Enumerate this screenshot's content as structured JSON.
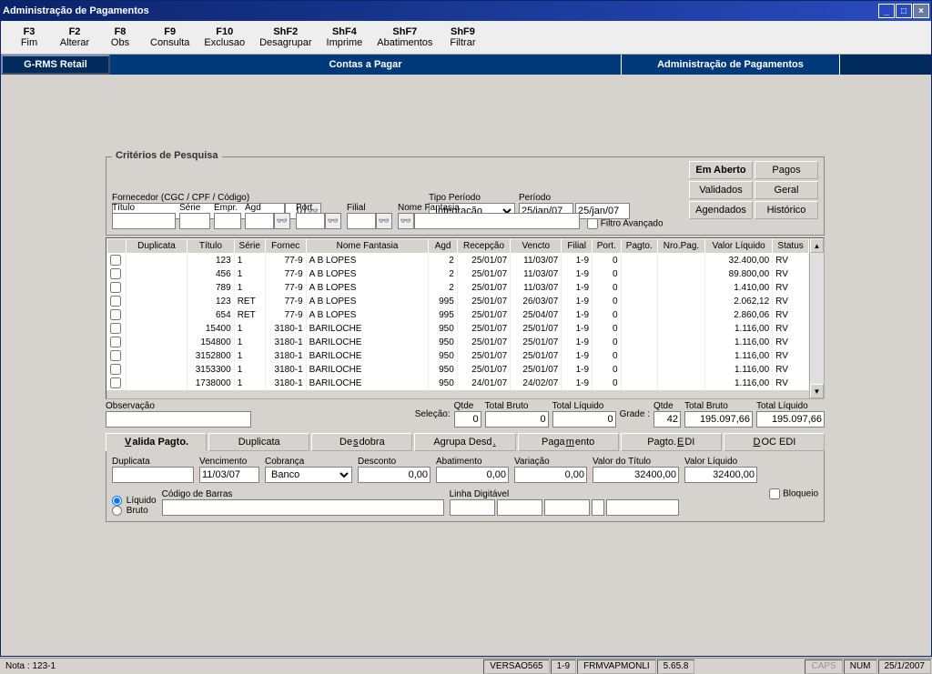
{
  "title": "Administração de Pagamentos",
  "menu": [
    {
      "key": "F3",
      "lbl": "Fim"
    },
    {
      "key": "F2",
      "lbl": "Alterar"
    },
    {
      "key": "F8",
      "lbl": "Obs"
    },
    {
      "key": "F9",
      "lbl": "Consulta"
    },
    {
      "key": "F10",
      "lbl": "Exclusao"
    },
    {
      "key": "ShF2",
      "lbl": "Desagrupar"
    },
    {
      "key": "ShF4",
      "lbl": "Imprime"
    },
    {
      "key": "ShF7",
      "lbl": "Abatimentos"
    },
    {
      "key": "ShF9",
      "lbl": "Filtrar"
    }
  ],
  "topbar": {
    "seg1": "G-RMS Retail",
    "seg2": "Contas a Pagar",
    "seg3": "Administração de Pagamentos"
  },
  "search": {
    "group": "Critérios de Pesquisa",
    "labels": {
      "fornecedor": "Fornecedor (CGC / CPF / Código)",
      "tipoPeriodo": "Tipo Período",
      "periodo": "Período",
      "titulo": "Título",
      "serie": "Série",
      "empr": "Empr.",
      "agd": "Agd",
      "port": "Port",
      "filial": "Filial",
      "nomeFant": "Nome Fantasia",
      "filtroAv": "Filtro Avançado"
    },
    "values": {
      "fornecQtd": "0",
      "tipoPeriodo": "Integração",
      "per1": "25/jan/07",
      "per2": "25/jan/07"
    },
    "buttons": {
      "emAberto": "Em Aberto",
      "pagos": "Pagos",
      "validados": "Validados",
      "geral": "Geral",
      "agendados": "Agendados",
      "historico": "Histórico"
    }
  },
  "columns": [
    "Duplicata",
    "Título",
    "Série",
    "Fornec",
    "Nome Fantasia",
    "Agd",
    "Recepção",
    "Vencto",
    "Filial",
    "Port.",
    "Pagto.",
    "Nro.Pag.",
    "Valor Líquido",
    "Status"
  ],
  "rows": [
    [
      "",
      "123",
      "1",
      "77-9",
      "A B LOPES",
      "2",
      "25/01/07",
      "11/03/07",
      "1-9",
      "0",
      "",
      "",
      "32.400,00",
      "RV"
    ],
    [
      "",
      "456",
      "1",
      "77-9",
      "A B LOPES",
      "2",
      "25/01/07",
      "11/03/07",
      "1-9",
      "0",
      "",
      "",
      "89.800,00",
      "RV"
    ],
    [
      "",
      "789",
      "1",
      "77-9",
      "A B LOPES",
      "2",
      "25/01/07",
      "11/03/07",
      "1-9",
      "0",
      "",
      "",
      "1.410,00",
      "RV"
    ],
    [
      "",
      "123",
      "RET",
      "77-9",
      "A B LOPES",
      "995",
      "25/01/07",
      "26/03/07",
      "1-9",
      "0",
      "",
      "",
      "2.062,12",
      "RV"
    ],
    [
      "",
      "654",
      "RET",
      "77-9",
      "A B LOPES",
      "995",
      "25/01/07",
      "25/04/07",
      "1-9",
      "0",
      "",
      "",
      "2.860,06",
      "RV"
    ],
    [
      "",
      "15400",
      "1",
      "3180-1",
      "BARILOCHE",
      "950",
      "25/01/07",
      "25/01/07",
      "1-9",
      "0",
      "",
      "",
      "1.116,00",
      "RV"
    ],
    [
      "",
      "154800",
      "1",
      "3180-1",
      "BARILOCHE",
      "950",
      "25/01/07",
      "25/01/07",
      "1-9",
      "0",
      "",
      "",
      "1.116,00",
      "RV"
    ],
    [
      "",
      "3152800",
      "1",
      "3180-1",
      "BARILOCHE",
      "950",
      "25/01/07",
      "25/01/07",
      "1-9",
      "0",
      "",
      "",
      "1.116,00",
      "RV"
    ],
    [
      "",
      "3153300",
      "1",
      "3180-1",
      "BARILOCHE",
      "950",
      "25/01/07",
      "25/01/07",
      "1-9",
      "0",
      "",
      "",
      "1.116,00",
      "RV"
    ],
    [
      "",
      "1738000",
      "1",
      "3180-1",
      "BARILOCHE",
      "950",
      "24/01/07",
      "24/02/07",
      "1-9",
      "0",
      "",
      "",
      "1.116,00",
      "RV"
    ]
  ],
  "totals": {
    "obs": "Observação",
    "qtd": "Qtde",
    "totBruto": "Total Bruto",
    "totLiq": "Total Líquido",
    "grade": "Grade :",
    "selecao": "Seleção:",
    "selQtd": "0",
    "selBruto": "0",
    "selLiq": "0",
    "gradeQtd": "42",
    "gradeBruto": "195.097,66",
    "gradeLiq": "195.097,66"
  },
  "tabs": {
    "valida": "Valida Pagto.",
    "dup": "Duplicata",
    "desdobra": "Desdobra",
    "agrupa": "Agrupa Desd.",
    "pagto": "Pagamento",
    "edi": "Pagto.EDI",
    "docedi": "DOC EDI"
  },
  "detail": {
    "labels": {
      "dup": "Duplicata",
      "venc": "Vencimento",
      "cobr": "Cobrança",
      "desc": "Desconto",
      "abat": "Abatimento",
      "var": "Variação",
      "valTit": "Valor do Título",
      "valLiq": "Valor Líquido",
      "codBarras": "Código de Barras",
      "linhaDig": "Linha Digitável",
      "liq": "Líquido",
      "bruto": "Bruto",
      "bloqueio": "Bloqueio"
    },
    "values": {
      "dup": "",
      "venc": "11/03/07",
      "cobr": "Banco",
      "desc": "0,00",
      "abat": "0,00",
      "var": "0,00",
      "valTit": "32400,00",
      "valLiq": "32400,00"
    }
  },
  "status": {
    "nota": "Nota : 123-1",
    "versao": "VERSAO565",
    "loja": "1-9",
    "form": "FRMVAPMONLI",
    "ver": "5.65.8",
    "caps": "CAPS",
    "num": "NUM",
    "date": "25/1/2007"
  }
}
